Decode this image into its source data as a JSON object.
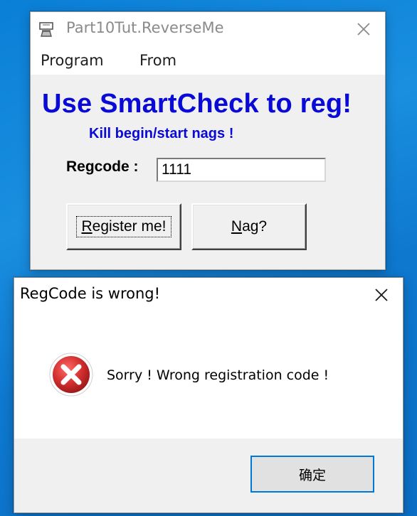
{
  "main_window": {
    "title": "Part10Tut.ReverseMe",
    "menu": [
      "Program",
      "From"
    ],
    "headline": "Use SmartCheck to reg!",
    "subline": "Kill begin/start nags !",
    "regcode_label": "Regcode :",
    "regcode_value": "1111",
    "register_button": {
      "mnemonic": "R",
      "rest": "egister me!"
    },
    "nag_button": {
      "mnemonic": "N",
      "rest": "ag?"
    },
    "text_color": "#0a0ad6"
  },
  "dialog": {
    "title": "RegCode is wrong!",
    "message": "Sorry ! Wrong registration code !",
    "ok_label": "确定",
    "icon": "error-icon",
    "icon_color": "#d32f2f"
  },
  "desktop": {
    "background": "#0a7fd6"
  }
}
